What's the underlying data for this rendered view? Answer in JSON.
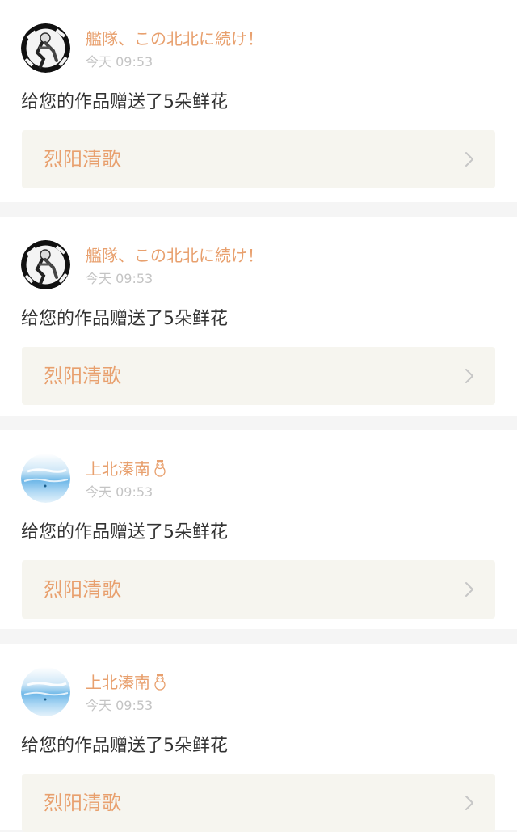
{
  "colors": {
    "username": "#e8a06e",
    "time": "#c4c4c4",
    "message": "#333333",
    "work_link_bg": "#f6f5ef",
    "separator": "#f5f5f5"
  },
  "notifications": [
    {
      "username": "艦隊、この北北に続け！",
      "username_emoji": "",
      "avatar_icon": "anime-character-avatar-icon",
      "time": "今天 09:53",
      "message": "给您的作品赠送了5朵鲜花",
      "work_title": "烈阳清歌"
    },
    {
      "username": "艦隊、この北北に続け！",
      "username_emoji": "",
      "avatar_icon": "anime-character-avatar-icon",
      "time": "今天 09:53",
      "message": "给您的作品赠送了5朵鲜花",
      "work_title": "烈阳清歌"
    },
    {
      "username": "上北溱南",
      "username_emoji": "snowman-icon",
      "avatar_icon": "sky-sea-avatar-icon",
      "time": "今天 09:53",
      "message": "给您的作品赠送了5朵鲜花",
      "work_title": "烈阳清歌"
    },
    {
      "username": "上北溱南",
      "username_emoji": "snowman-icon",
      "avatar_icon": "sky-sea-avatar-icon",
      "time": "今天 09:53",
      "message": "给您的作品赠送了5朵鲜花",
      "work_title": "烈阳清歌"
    }
  ]
}
